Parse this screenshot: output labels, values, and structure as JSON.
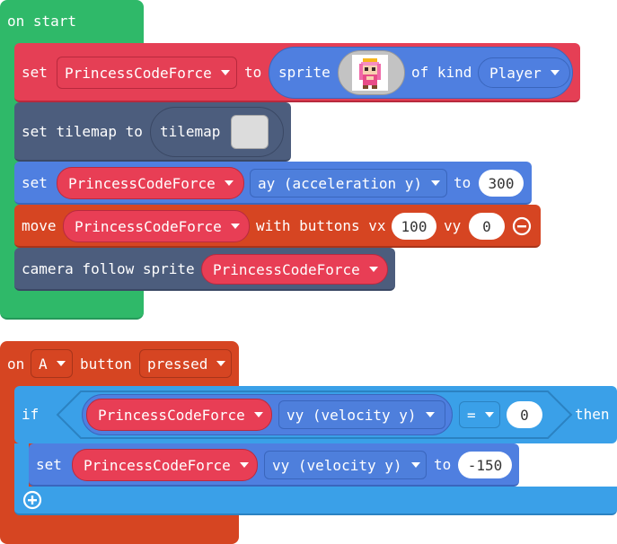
{
  "colors": {
    "green": "#2fb969",
    "red": "#e53f55",
    "dark_blue": "#4c5d7d",
    "blue": "#4f7fe0",
    "orange_red": "#d64522",
    "light_blue": "#3aa0e8",
    "sprite_red": "#e83e55"
  },
  "on_start": {
    "label": "on start",
    "set_sprite": {
      "set": "set",
      "variable": "PrincessCodeForce",
      "to": "to",
      "sprite": "sprite",
      "of_kind": "of kind",
      "kind": "Player"
    },
    "set_tilemap": {
      "label": "set tilemap to",
      "tilemap": "tilemap"
    },
    "set_accel": {
      "set": "set",
      "variable": "PrincessCodeForce",
      "property": "ay (acceleration y)",
      "to": "to",
      "value": "300"
    },
    "move": {
      "move": "move",
      "variable": "PrincessCodeForce",
      "with_buttons": "with buttons vx",
      "vx": "100",
      "vy_label": "vy",
      "vy": "0"
    },
    "camera": {
      "label": "camera follow sprite",
      "variable": "PrincessCodeForce"
    }
  },
  "on_button": {
    "on": "on",
    "button": "A",
    "button_label": "button",
    "event": "pressed",
    "if": "if",
    "condition_variable": "PrincessCodeForce",
    "condition_property": "vy (velocity y)",
    "operator": "=",
    "condition_value": "0",
    "then": "then",
    "set": "set",
    "set_variable": "PrincessCodeForce",
    "set_property": "vy (velocity y)",
    "set_to": "to",
    "set_value": "-150"
  }
}
